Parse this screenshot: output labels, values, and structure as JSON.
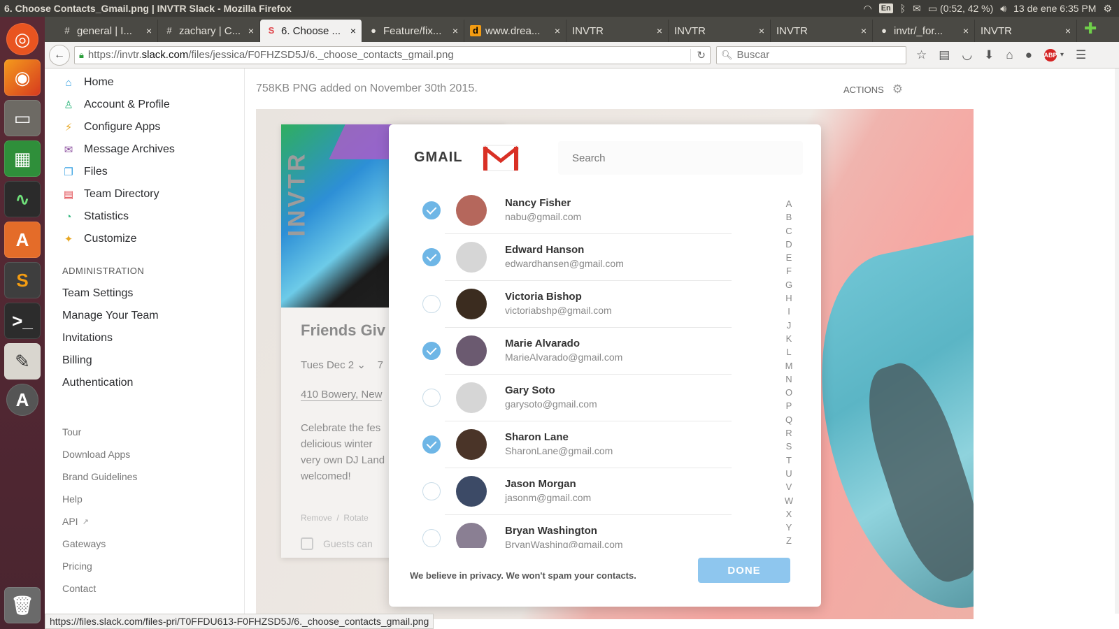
{
  "system": {
    "window_title": "6. Choose Contacts_Gmail.png | INVTR Slack - Mozilla Firefox",
    "keyboard_layout": "En",
    "battery": "(0:52, 42 %)",
    "datetime": "13 de ene  6:35 PM"
  },
  "browser": {
    "tabs": [
      {
        "label": "general | I...",
        "favicon": "#"
      },
      {
        "label": "zachary | C...",
        "favicon": "#"
      },
      {
        "label": "6. Choose ...",
        "favicon": "S"
      },
      {
        "label": "Feature/fix...",
        "favicon": "●"
      },
      {
        "label": "www.drea...",
        "favicon": "d"
      },
      {
        "label": "INVTR",
        "favicon": ""
      },
      {
        "label": "INVTR",
        "favicon": ""
      },
      {
        "label": "INVTR",
        "favicon": ""
      },
      {
        "label": "invtr/_for...",
        "favicon": "●"
      },
      {
        "label": "INVTR",
        "favicon": ""
      }
    ],
    "url_prefix": "https://invtr.",
    "url_domain": "slack.com",
    "url_path": "/files/jessica/F0FHZSD5J/6._choose_contacts_gmail.png",
    "search_placeholder": "Buscar",
    "status_url": "https://files.slack.com/files-pri/T0FFDU613-F0FHZSD5J/6._choose_contacts_gmail.png"
  },
  "sidebar": {
    "items": [
      {
        "label": "Home",
        "icon": "⌂",
        "color": "#3aa3e3"
      },
      {
        "label": "Account & Profile",
        "icon": "♙",
        "color": "#2fb67c"
      },
      {
        "label": "Configure Apps",
        "icon": "⚡",
        "color": "#e8a723"
      },
      {
        "label": "Message Archives",
        "icon": "✉",
        "color": "#8b4f9e"
      },
      {
        "label": "Files",
        "icon": "❐",
        "color": "#3aa3e3"
      },
      {
        "label": "Team Directory",
        "icon": "▤",
        "color": "#e0464c"
      },
      {
        "label": "Statistics",
        "icon": "◔",
        "color": "#2fb67c"
      },
      {
        "label": "Customize",
        "icon": "✦",
        "color": "#e8a723"
      }
    ],
    "admin_heading": "ADMINISTRATION",
    "admin_items": [
      "Team Settings",
      "Manage Your Team",
      "Invitations",
      "Billing",
      "Authentication"
    ],
    "footer_items": [
      "Tour",
      "Download Apps",
      "Brand Guidelines",
      "Help",
      "API",
      "Gateways",
      "Pricing",
      "Contact"
    ]
  },
  "file": {
    "meta": "758KB PNG added on November 30th 2015.",
    "actions_label": "ACTIONS"
  },
  "preview": {
    "invtr_label": "INVTR",
    "event_title": "Friends Giv",
    "event_date": "Tues Dec 2",
    "event_time_fragment": "7",
    "event_address": "410 Bowery, New",
    "event_description": "Celebrate the fes\ndelicious winter\nvery own DJ Land\nwelcomed!",
    "remove_label": "Remove",
    "link_separator": "/",
    "rotate_label": "Rotate",
    "guests_label": "Guests can",
    "modal": {
      "brand": "GMAIL",
      "search_placeholder": "Search",
      "contacts": [
        {
          "name": "Nancy Fisher",
          "email": "nabu@gmail.com",
          "checked": true,
          "avatar_color": "#b5675c"
        },
        {
          "name": "Edward Hanson",
          "email": "edwardhansen@gmail.com",
          "checked": true,
          "avatar_color": "#d6d6d6"
        },
        {
          "name": "Victoria Bishop",
          "email": "victoriabshp@gmail.com",
          "checked": false,
          "avatar_color": "#3b2c1f"
        },
        {
          "name": "Marie Alvarado",
          "email": "MarieAlvarado@gmail.com",
          "checked": true,
          "avatar_color": "#6b5a70"
        },
        {
          "name": "Gary Soto",
          "email": "garysoto@gmail.com",
          "checked": false,
          "avatar_color": "#d6d6d6"
        },
        {
          "name": "Sharon Lane",
          "email": "SharonLane@gmail.com",
          "checked": true,
          "avatar_color": "#4a3428"
        },
        {
          "name": "Jason Morgan",
          "email": "jasonm@gmail.com",
          "checked": false,
          "avatar_color": "#3c4a66"
        },
        {
          "name": "Bryan Washington",
          "email": "BryanWashing@gmail.com",
          "checked": false,
          "avatar_color": "#8a7f93"
        }
      ],
      "alphabet": [
        "A",
        "B",
        "C",
        "D",
        "E",
        "F",
        "G",
        "H",
        "I",
        "J",
        "K",
        "L",
        "M",
        "N",
        "O",
        "P",
        "Q",
        "R",
        "S",
        "T",
        "U",
        "V",
        "W",
        "X",
        "Y",
        "Z"
      ],
      "privacy_note": "We believe in privacy. We won't spam your contacts.",
      "done_label": "DONE"
    }
  }
}
